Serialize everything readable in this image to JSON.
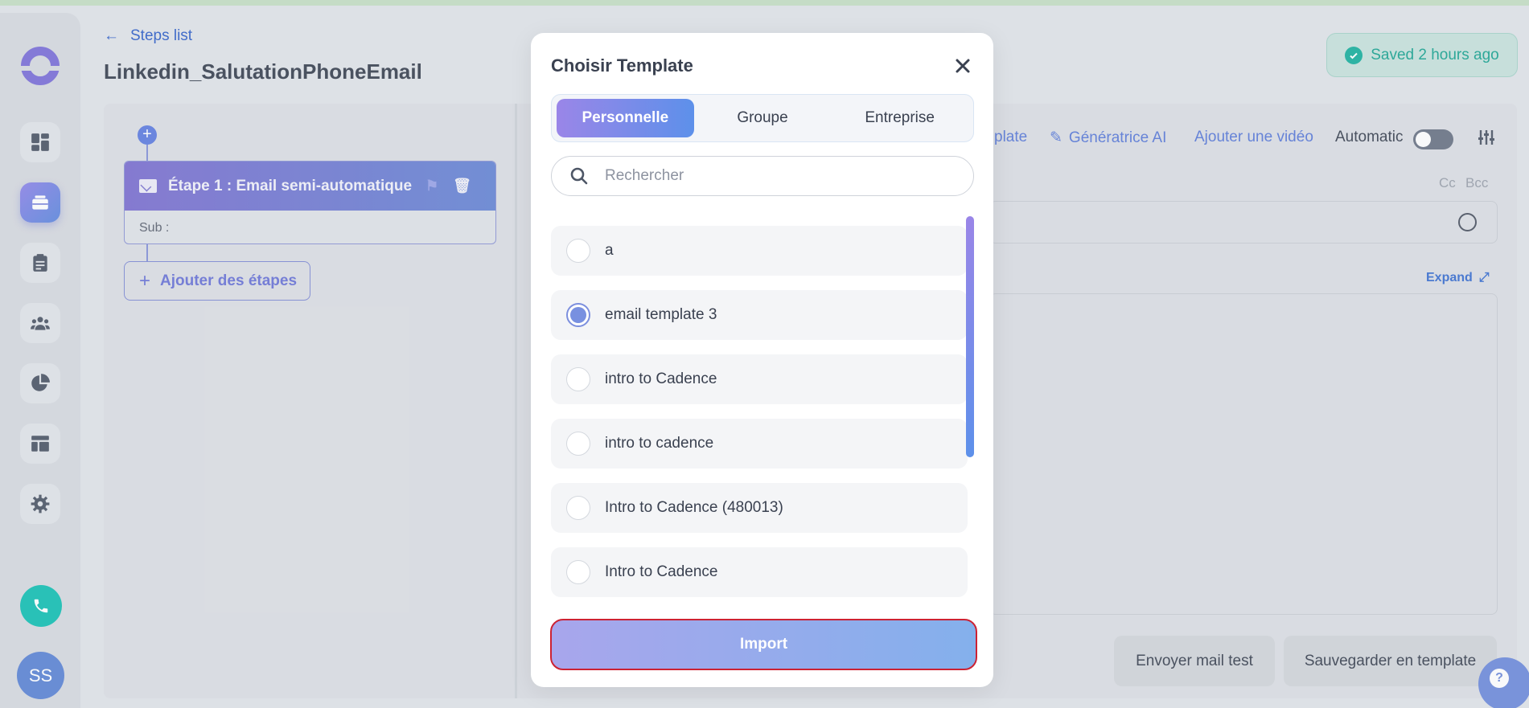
{
  "header": {
    "back_label": "Steps list",
    "title": "Linkedin_SalutationPhoneEmail",
    "saved_status": "Saved 2 hours ago"
  },
  "sidebar": {
    "icons": [
      "dashboard-icon",
      "cadences-icon",
      "tasks-icon",
      "people-icon",
      "reports-icon",
      "templates-icon",
      "settings-icon"
    ],
    "active_index": 1,
    "avatar_initials": "SS"
  },
  "steps": {
    "step1_title": "Étape 1 : Email semi-automatique",
    "step1_sub": "Sub :",
    "add_steps_label": "Ajouter des étapes"
  },
  "editor": {
    "toolbar": {
      "template_partial": "plate",
      "ai_label": "Génératrice AI",
      "video_label": "Ajouter une vidéo",
      "automatic_label": "Automatic"
    },
    "cc_label": "Cc",
    "bcc_label": "Bcc",
    "expand_label": "Expand",
    "send_test_label": "Envoyer mail test",
    "save_template_label": "Sauvegarder en template"
  },
  "modal": {
    "title": "Choisir Template",
    "tabs": [
      "Personnelle",
      "Groupe",
      "Entreprise"
    ],
    "active_tab": 0,
    "search_placeholder": "Rechercher",
    "templates": [
      {
        "name": "a",
        "selected": false
      },
      {
        "name": "email template 3",
        "selected": true
      },
      {
        "name": "intro to Cadence",
        "selected": false
      },
      {
        "name": "intro to cadence",
        "selected": false
      },
      {
        "name": "Intro to Cadence (480013)",
        "selected": false
      },
      {
        "name": "Intro to Cadence",
        "selected": false
      }
    ],
    "import_label": "Import"
  },
  "colors": {
    "accent_purple": "#7b6fd8",
    "accent_blue": "#5d90ea",
    "saved_green": "#1aa391",
    "import_border": "#cc2233"
  }
}
